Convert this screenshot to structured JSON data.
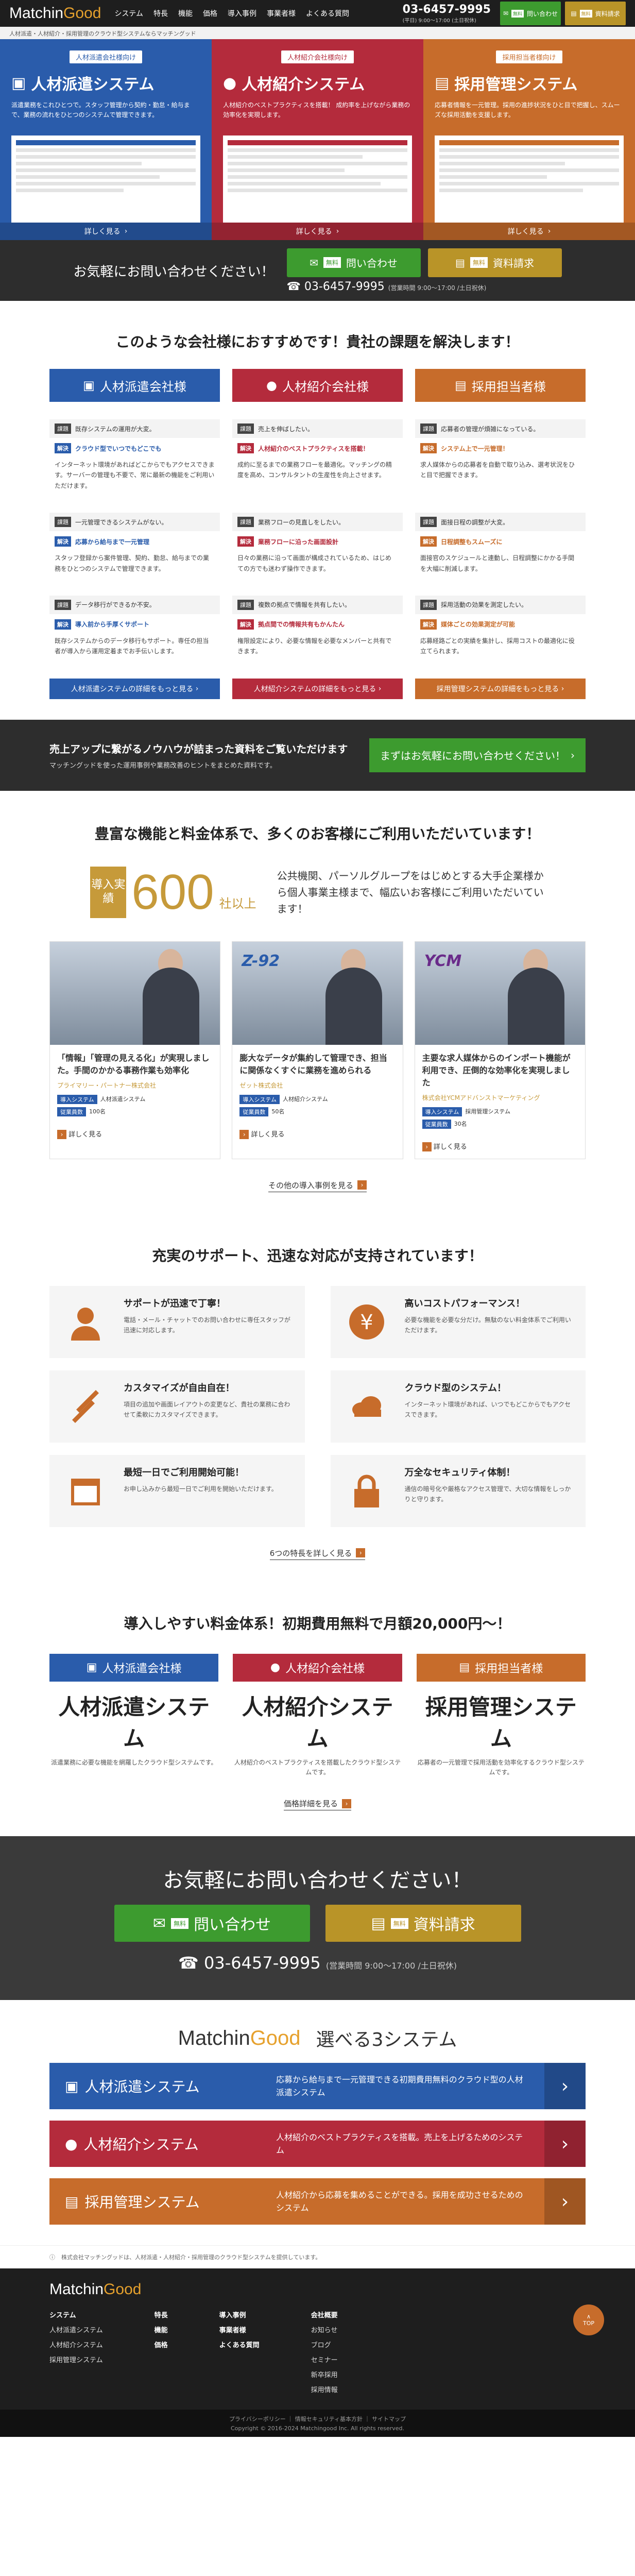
{
  "header": {
    "logo_a": "Matchin",
    "logo_b": "Good",
    "nav": [
      "システム",
      "特長",
      "機能",
      "価格",
      "導入事例",
      "事業者様",
      "よくある質問"
    ],
    "tel": "03-6457-9995",
    "hours": "(平日) 9:00〜17:00 (土日祝休)",
    "btn_contact": "問い合わせ",
    "btn_doc": "資料請求",
    "free": "無料"
  },
  "breadcrumb": "人材派遣・人材紹介・採用管理のクラウド型システムならマッチングッド",
  "hero": [
    {
      "tag": "人材派遣会社様向け",
      "title": "人材派遣システム",
      "desc": "派遣業務をこれひとつで。スタッフ管理から契約・勤怠・給与まで、業務の流れをひとつのシステムで管理できます。",
      "more": "詳しく見る"
    },
    {
      "tag": "人材紹介会社様向け",
      "title": "人材紹介システム",
      "desc": "人材紹介のベストプラクティスを搭載！ 成約率を上げながら業務の効率化を実現します。",
      "more": "詳しく見る"
    },
    {
      "tag": "採用担当者様向け",
      "title": "採用管理システム",
      "desc": "応募者情報を一元管理。採用の進捗状況をひと目で把握し、スムーズな採用活動を支援します。",
      "more": "詳しく見る"
    }
  ],
  "cta1": {
    "msg": "お気軽にお問い合わせください！",
    "contact": "問い合わせ",
    "doc": "資料請求",
    "free": "無料",
    "tel": "03-6457-9995",
    "hours": "(営業時間 9:00〜17:00 /土日祝休)"
  },
  "recommend": {
    "title": "このような会社様におすすめです！貴社の課題を解決します！",
    "heads": [
      "人材派遣会社様",
      "人材紹介会社様",
      "採用担当者様"
    ],
    "problem_key": "課題",
    "solution_key": "解決",
    "rows": [
      [
        {
          "p": "既存システムの運用が大変。",
          "s": "クラウド型でいつでもどこでも",
          "b": "インターネット環境があればどこからでもアクセスできます。サーバーの管理も不要で、常に最新の機能をご利用いただけます。"
        },
        {
          "p": "売上を伸ばしたい。",
          "s": "人材紹介のベストプラクティスを搭載！",
          "b": "成約に至るまでの業務フローを最適化。マッチングの精度を高め、コンサルタントの生産性を向上させます。"
        },
        {
          "p": "応募者の管理が煩雑になっている。",
          "s": "システム上で一元管理！",
          "b": "求人媒体からの応募者を自動で取り込み、選考状況をひと目で把握できます。"
        }
      ],
      [
        {
          "p": "一元管理できるシステムがない。",
          "s": "応募から給与まで一元管理",
          "b": "スタッフ登録から案件管理、契約、勤怠、給与までの業務をひとつのシステムで管理できます。"
        },
        {
          "p": "業務フローの見直しをしたい。",
          "s": "業務フローに沿った画面設計",
          "b": "日々の業務に沿って画面が構成されているため、はじめての方でも迷わず操作できます。"
        },
        {
          "p": "面接日程の調整が大変。",
          "s": "日程調整もスムーズに",
          "b": "面接官のスケジュールと連動し、日程調整にかかる手間を大幅に削減します。"
        }
      ],
      [
        {
          "p": "データ移行ができるか不安。",
          "s": "導入前から手厚くサポート",
          "b": "既存システムからのデータ移行もサポート。専任の担当者が導入から運用定着までお手伝いします。"
        },
        {
          "p": "複数の拠点で情報を共有したい。",
          "s": "拠点間での情報共有もかんたん",
          "b": "権限設定により、必要な情報を必要なメンバーと共有できます。"
        },
        {
          "p": "採用活動の効果を測定したい。",
          "s": "媒体ごとの効果測定が可能",
          "b": "応募経路ごとの実績を集計し、採用コストの最適化に役立てられます。"
        }
      ]
    ],
    "links": [
      "人材派遣システムの詳細をもっと見る",
      "人材紹介システムの詳細をもっと見る",
      "採用管理システムの詳細をもっと見る"
    ]
  },
  "knowhow": {
    "title": "売上アップに繋がるノウハウが詰まった資料をご覧いただけます",
    "desc": "マッチングッドを使った運用事例や業務改善のヒントをまとめた資料です。",
    "btn": "まずはお気軽にお問い合わせください！"
  },
  "records": {
    "title": "豊富な機能と料金体系で、多くのお客様にご利用いただいています！",
    "label": "導入実績",
    "num": "600",
    "unit": "社以上",
    "desc": "公共機関、パーソルグループをはじめとする大手企業様から個人事業主様まで、幅広いお客様にご利用いただいています！",
    "cases": [
      {
        "logo": "",
        "ttl": "「情報」「管理の見える化」が実現しました。手間のかかる事務作業も効率化",
        "co": "プライマリー・パートナー株式会社",
        "tags": [
          [
            "導入システム",
            "人材派遣システム"
          ],
          [
            "従業員数",
            "100名"
          ]
        ],
        "more": "詳しく見る"
      },
      {
        "logo": "Z-92",
        "ttl": "膨大なデータが集約して管理でき、担当に関係なくすぐに業務を進められる",
        "co": "ゼット株式会社",
        "tags": [
          [
            "導入システム",
            "人材紹介システム"
          ],
          [
            "従業員数",
            "50名"
          ]
        ],
        "more": "詳しく見る"
      },
      {
        "logo": "YCM",
        "ttl": "主要な求人媒体からのインポート機能が利用でき、圧倒的な効率化を実現しました",
        "co": "株式会社YCMアドバンストマーケティング",
        "tags": [
          [
            "導入システム",
            "採用管理システム"
          ],
          [
            "従業員数",
            "30名"
          ]
        ],
        "more": "詳しく見る"
      }
    ],
    "more": "その他の導入事例を見る"
  },
  "support": {
    "title": "充実のサポート、迅速な対応が支持されています！",
    "items": [
      {
        "t": "サポートが迅速で丁寧！",
        "d": "電話・メール・チャットでのお問い合わせに専任スタッフが迅速に対応します。",
        "icon": "support-icon"
      },
      {
        "t": "高いコストパフォーマンス！",
        "d": "必要な機能を必要な分だけ。無駄のない料金体系でご利用いただけます。",
        "icon": "yen-icon"
      },
      {
        "t": "カスタマイズが自由自在！",
        "d": "項目の追加や画面レイアウトの変更など、貴社の業務に合わせて柔軟にカスタマイズできます。",
        "icon": "tools-icon"
      },
      {
        "t": "クラウド型のシステム！",
        "d": "インターネット環境があれば、いつでもどこからでもアクセスできます。",
        "icon": "cloud-icon"
      },
      {
        "t": "最短一日でご利用開始可能！",
        "d": "お申し込みから最短一日でご利用を開始いただけます。",
        "icon": "calendar-icon"
      },
      {
        "t": "万全なセキュリティ体制！",
        "d": "通信の暗号化や厳格なアクセス管理で、大切な情報をしっかりと守ります。",
        "icon": "lock-icon"
      }
    ],
    "more": "6つの特長を詳しく見る"
  },
  "price": {
    "title": "導入しやすい料金体系！初期費用無料で月額20,000円〜！",
    "cols": [
      {
        "head": "人材派遣会社様",
        "name": "人材派遣システム",
        "desc": "派遣業務に必要な機能を網羅したクラウド型システムです。"
      },
      {
        "head": "人材紹介会社様",
        "name": "人材紹介システム",
        "desc": "人材紹介のベストプラクティスを搭載したクラウド型システムです。"
      },
      {
        "head": "採用担当者様",
        "name": "採用管理システム",
        "desc": "応募者の一元管理で採用活動を効率化するクラウド型システムです。"
      }
    ],
    "more": "価格詳細を見る"
  },
  "cta2": {
    "msg": "お気軽にお問い合わせください！",
    "contact": "問い合わせ",
    "doc": "資料請求",
    "free": "無料",
    "tel": "03-6457-9995",
    "hours": "(営業時間 9:00〜17:00 /土日祝休)"
  },
  "select": {
    "logo_a": "Matchin",
    "logo_b": "Good",
    "title": "選べる3システム",
    "rows": [
      {
        "name": "人材派遣システム",
        "txt": "応募から給与まで一元管理できる初期費用無料のクラウド型の人材派遣システム"
      },
      {
        "name": "人材紹介システム",
        "txt": "人材紹介のベストプラクティスを搭載。売上を上げるためのシステム"
      },
      {
        "name": "採用管理システム",
        "txt": "人材紹介から応募を集めることができる。採用を成功させるためのシステム"
      }
    ]
  },
  "footer_note": "株式会社マッチングッドは、人材派遣・人材紹介・採用管理のクラウド型システムを提供しています。",
  "footer": {
    "logo_a": "Matchin",
    "logo_b": "Good",
    "cols": [
      [
        "システム",
        "人材派遣システム",
        "人材紹介システム",
        "採用管理システム"
      ],
      [
        "特長",
        "機能",
        "価格"
      ],
      [
        "導入事例",
        "事業者様",
        "よくある質問"
      ],
      [
        "会社概要",
        "お知らせ",
        "ブログ",
        "セミナー",
        "新卒採用",
        "採用情報"
      ]
    ],
    "top": "TOP",
    "links": "プライバシーポリシー ｜ 情報セキュリティ基本方針 ｜ サイトマップ",
    "copy": "Copyright © 2016-2024 Matchingood Inc. All rights reserved."
  }
}
